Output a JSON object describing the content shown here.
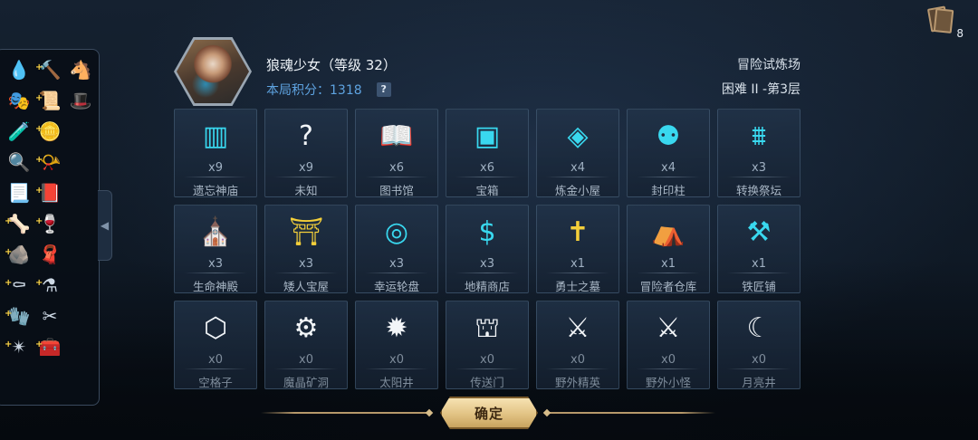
{
  "header": {
    "player_name": "狼魂少女（等级 32）",
    "score_label": "本局积分：",
    "score_value": "1318",
    "help_label": "?",
    "location": "冒险试炼场",
    "floor": "困难 II -第3层"
  },
  "card_counter": {
    "count": "8",
    "icon": "card-stack-icon"
  },
  "inventory": [
    {
      "icon": "water-drop-icon",
      "glyph": "💧",
      "plus": false
    },
    {
      "icon": "hammer-icon",
      "glyph": "🔨",
      "plus": true
    },
    {
      "icon": "horse-head-icon",
      "glyph": "🐴",
      "plus": false
    },
    {
      "icon": "dark-hood-icon",
      "glyph": "🎭",
      "plus": false
    },
    {
      "icon": "spell-page-icon",
      "glyph": "📜",
      "plus": true
    },
    {
      "icon": "witch-hat-icon",
      "glyph": "🎩",
      "plus": false
    },
    {
      "icon": "green-potion-icon",
      "glyph": "🧪",
      "plus": false
    },
    {
      "icon": "gold-coin-icon",
      "glyph": "🪙",
      "plus": true
    },
    {
      "icon": "empty-slot",
      "glyph": "",
      "plus": false
    },
    {
      "icon": "magnifier-icon",
      "glyph": "🔍",
      "plus": false
    },
    {
      "icon": "red-horn-icon",
      "glyph": "📯",
      "plus": true
    },
    {
      "icon": "empty-slot",
      "glyph": "",
      "plus": false
    },
    {
      "icon": "scroll-icon",
      "glyph": "📃",
      "plus": false
    },
    {
      "icon": "spellbook-icon",
      "glyph": "📕",
      "plus": true
    },
    {
      "icon": "empty-slot",
      "glyph": "",
      "plus": false
    },
    {
      "icon": "bone-scroll-icon",
      "glyph": "🦴",
      "plus": true
    },
    {
      "icon": "red-potion-icon",
      "glyph": "🍷",
      "plus": true
    },
    {
      "icon": "empty-slot",
      "glyph": "",
      "plus": false
    },
    {
      "icon": "dark-ore-icon",
      "glyph": "🪨",
      "plus": true
    },
    {
      "icon": "red-cloak-icon",
      "glyph": "🧣",
      "plus": false
    },
    {
      "icon": "empty-slot",
      "glyph": "",
      "plus": false
    },
    {
      "icon": "coffin-icon",
      "glyph": "⚰",
      "plus": true
    },
    {
      "icon": "potion-set-icon",
      "glyph": "⚗",
      "plus": true
    },
    {
      "icon": "empty-slot",
      "glyph": "",
      "plus": false
    },
    {
      "icon": "glove-icon",
      "glyph": "🧤",
      "plus": true
    },
    {
      "icon": "tongs-icon",
      "glyph": "✂",
      "plus": false
    },
    {
      "icon": "empty-slot",
      "glyph": "",
      "plus": false
    },
    {
      "icon": "spiked-ring-icon",
      "glyph": "✴",
      "plus": true
    },
    {
      "icon": "treasure-box-icon",
      "glyph": "🧰",
      "plus": true
    }
  ],
  "tiles": [
    {
      "label": "遗忘神庙",
      "count": "x9",
      "icon": "forgotten-temple-icon",
      "glyph": "▥",
      "color": "cyan",
      "dim": false
    },
    {
      "label": "未知",
      "count": "x9",
      "icon": "question-mark-icon",
      "glyph": "?",
      "color": "white",
      "dim": false
    },
    {
      "label": "图书馆",
      "count": "x6",
      "icon": "open-book-icon",
      "glyph": "📖",
      "color": "cyan",
      "dim": false
    },
    {
      "label": "宝箱",
      "count": "x6",
      "icon": "mimic-chest-icon",
      "glyph": "▣",
      "color": "cyan",
      "dim": false
    },
    {
      "label": "炼金小屋",
      "count": "x4",
      "icon": "alchemy-star-icon",
      "glyph": "◈",
      "color": "cyan",
      "dim": false
    },
    {
      "label": "封印柱",
      "count": "x4",
      "icon": "seal-pillar-icon",
      "glyph": "⚉",
      "color": "cyan",
      "dim": false
    },
    {
      "label": "转换祭坛",
      "count": "x3",
      "icon": "altar-icon",
      "glyph": "⩩",
      "color": "cyan",
      "dim": false
    },
    {
      "label": "生命神殿",
      "count": "x3",
      "icon": "life-shrine-icon",
      "glyph": "⛪",
      "color": "cyan",
      "dim": false
    },
    {
      "label": "矮人宝屋",
      "count": "x3",
      "icon": "dwarf-vault-icon",
      "glyph": "⛩",
      "color": "gold",
      "dim": false
    },
    {
      "label": "幸运轮盘",
      "count": "x3",
      "icon": "roulette-icon",
      "glyph": "◎",
      "color": "cyan",
      "dim": false
    },
    {
      "label": "地精商店",
      "count": "x3",
      "icon": "goblin-shop-icon",
      "glyph": "$",
      "color": "cyan",
      "dim": false
    },
    {
      "label": "勇士之墓",
      "count": "x1",
      "icon": "tombstone-icon",
      "glyph": "✝",
      "color": "gold",
      "dim": false
    },
    {
      "label": "冒险者仓库",
      "count": "x1",
      "icon": "warehouse-icon",
      "glyph": "⛺",
      "color": "gold",
      "dim": false
    },
    {
      "label": "铁匠铺",
      "count": "x1",
      "icon": "anvil-icon",
      "glyph": "⚒",
      "color": "cyan",
      "dim": false
    },
    {
      "label": "空格子",
      "count": "x0",
      "icon": "empty-hexagon-icon",
      "glyph": "⬡",
      "color": "white",
      "dim": true
    },
    {
      "label": "魔晶矿洞",
      "count": "x0",
      "icon": "crystal-mine-icon",
      "glyph": "⚙",
      "color": "white",
      "dim": true
    },
    {
      "label": "太阳井",
      "count": "x0",
      "icon": "sun-well-icon",
      "glyph": "✹",
      "color": "white",
      "dim": true
    },
    {
      "label": "传送门",
      "count": "x0",
      "icon": "portal-icon",
      "glyph": "⛫",
      "color": "white",
      "dim": true
    },
    {
      "label": "野外精英",
      "count": "x0",
      "icon": "crossed-axes-icon",
      "glyph": "⚔",
      "color": "white",
      "dim": true
    },
    {
      "label": "野外小怪",
      "count": "x0",
      "icon": "crossed-swords-icon",
      "glyph": "⚔",
      "color": "white",
      "dim": true
    },
    {
      "label": "月亮井",
      "count": "x0",
      "icon": "moon-well-icon",
      "glyph": "☾",
      "color": "white",
      "dim": true
    }
  ],
  "confirm_label": "确定"
}
